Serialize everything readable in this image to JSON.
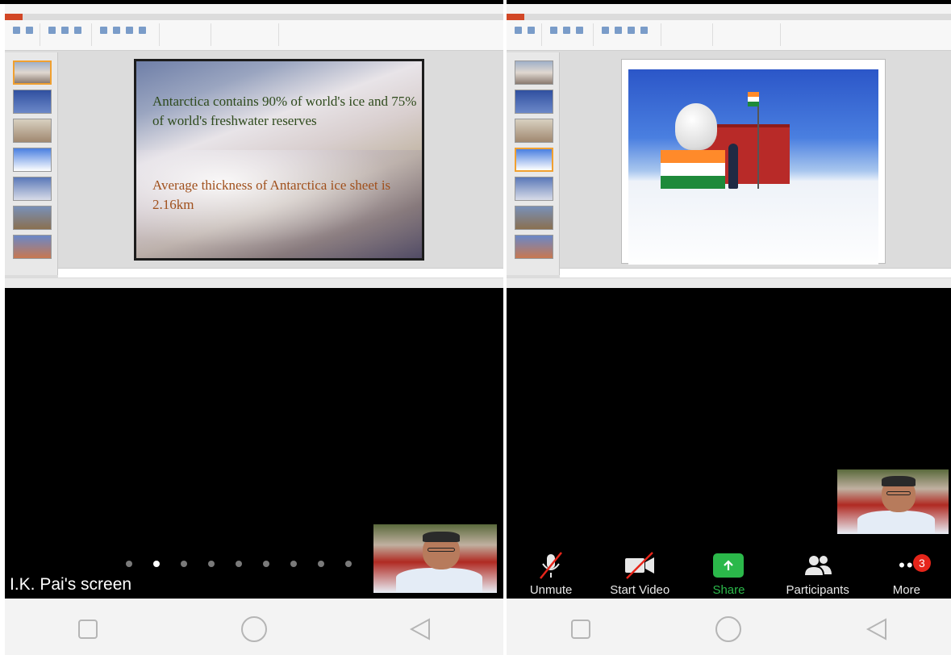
{
  "left_panel": {
    "slide": {
      "text_1": "Antarctica contains 90% of world's ice and 75% of world's freshwater reserves",
      "text_2": "Average thickness of Antarctica ice sheet is 2.16km"
    },
    "screen_label": "I.K. Pai's screen",
    "page_dots": {
      "count": 9,
      "active_index": 1
    }
  },
  "right_panel": {
    "toolbar": {
      "unmute_label": "Unmute",
      "start_video_label": "Start Video",
      "share_label": "Share",
      "participants_label": "Participants",
      "more_label": "More",
      "more_badge": "3"
    }
  },
  "colors": {
    "share_green": "#2bb84a",
    "badge_red": "#e6251a",
    "slide_green_text": "#2e4a1c",
    "slide_orange_text": "#a0501c"
  },
  "icons": {
    "unmute": "microphone-off-icon",
    "start_video": "video-off-icon",
    "share": "share-up-arrow-icon",
    "participants": "participants-icon",
    "more": "more-dots-icon",
    "nav_recent": "square-icon",
    "nav_home": "circle-icon",
    "nav_back": "triangle-back-icon"
  }
}
